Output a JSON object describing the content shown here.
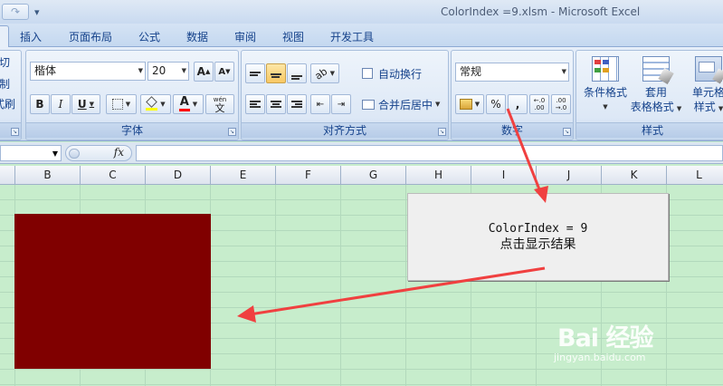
{
  "window": {
    "title": "ColorIndex =9.xlsm - Microsoft Excel",
    "quick_access": {
      "redo_glyph": "↷",
      "customize_glyph": "▾"
    }
  },
  "tabs": [
    {
      "label": "插入"
    },
    {
      "label": "页面布局"
    },
    {
      "label": "公式"
    },
    {
      "label": "数据"
    },
    {
      "label": "审阅"
    },
    {
      "label": "视图"
    },
    {
      "label": "开发工具"
    }
  ],
  "ribbon": {
    "clipboard": {
      "cut_fragment": "切",
      "copy_fragment": "制",
      "painter_fragment": "式刷"
    },
    "font": {
      "label": "字体",
      "font_name": "楷体",
      "font_size": "20",
      "grow": "A",
      "shrink": "A",
      "bold": "B",
      "italic": "I",
      "underline": "U",
      "font_color_letter": "A",
      "phonetic": "wén",
      "phonetic_char": "文",
      "fill_color": "#ffff00",
      "text_color": "#ff0000"
    },
    "alignment": {
      "label": "对齐方式",
      "wrap_text": "自动换行",
      "merge_center": "合并后居中"
    },
    "number": {
      "label": "数字",
      "format": "常规",
      "percent": "%",
      "comma": ",",
      "inc_decimal": "←.0 .00",
      "dec_decimal": ".00 →.0"
    },
    "styles": {
      "label": "样式",
      "conditional_line1": "条件格式",
      "table_line1": "套用",
      "table_line2": "表格格式",
      "cell_line1": "单元格",
      "cell_line2": "样式"
    }
  },
  "formula_bar": {
    "fx": "fx",
    "name_value": "",
    "formula_value": ""
  },
  "columns": [
    "B",
    "C",
    "D",
    "E",
    "F",
    "G",
    "H",
    "I",
    "J",
    "K",
    "L"
  ],
  "sheet": {
    "shape_fill": "#800000",
    "macro_button": {
      "line1": "ColorIndex = 9",
      "line2": "点击显示结果"
    },
    "arrow_color": "#f04040"
  },
  "watermark": {
    "logo": "Bai 经验",
    "url": "jingyan.baidu.com"
  }
}
